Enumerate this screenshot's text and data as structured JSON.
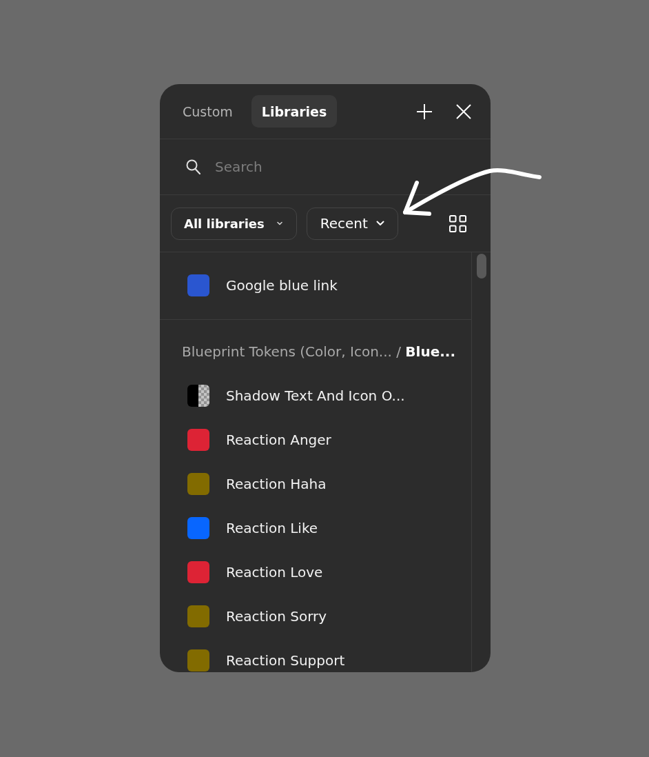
{
  "tabs": [
    {
      "label": "Custom",
      "selected": false
    },
    {
      "label": "Libraries",
      "selected": true
    }
  ],
  "search": {
    "placeholder": "Search"
  },
  "filters": [
    {
      "label": "All libraries",
      "kind": "scope"
    },
    {
      "label": "Recent",
      "kind": "sort"
    }
  ],
  "sections": [
    {
      "items": [
        {
          "name": "Google blue link",
          "kind": "solid",
          "color": "#2a56d0"
        }
      ]
    },
    {
      "title": "Blueprint Tokens (Color, Icon... / **Blue...**",
      "items": [
        {
          "name": "Shadow Text And Icon O...",
          "kind": "split",
          "color": "#000000"
        },
        {
          "name": "Reaction Anger",
          "kind": "solid",
          "color": "#dd2335"
        },
        {
          "name": "Reaction Haha",
          "kind": "solid",
          "color": "#826b00"
        },
        {
          "name": "Reaction Like",
          "kind": "solid",
          "color": "#0866ff"
        },
        {
          "name": "Reaction Love",
          "kind": "solid",
          "color": "#dd2335"
        },
        {
          "name": "Reaction Sorry",
          "kind": "solid",
          "color": "#826b00"
        },
        {
          "name": "Reaction Support",
          "kind": "solid",
          "color": "#826b00"
        }
      ]
    }
  ]
}
